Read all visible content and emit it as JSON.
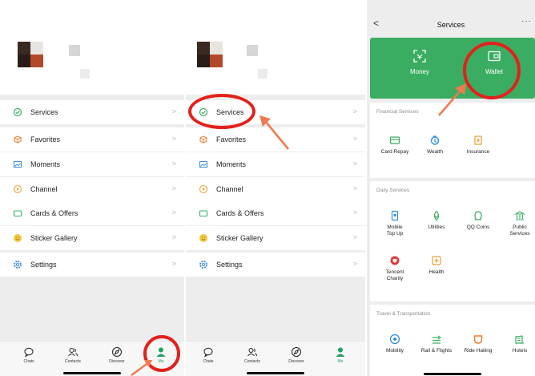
{
  "me_menu": [
    {
      "label": "Services",
      "icon": "services-icon"
    },
    {
      "label": "Favorites",
      "icon": "favorites-icon"
    },
    {
      "label": "Moments",
      "icon": "moments-icon"
    },
    {
      "label": "Channel",
      "icon": "channel-icon"
    },
    {
      "label": "Cards & Offers",
      "icon": "cards-offers-icon"
    },
    {
      "label": "Sticker Gallery",
      "icon": "sticker-gallery-icon"
    },
    {
      "label": "Settings",
      "icon": "settings-icon"
    }
  ],
  "chevron": ">",
  "tabs": [
    {
      "label": "Chats",
      "icon": "chats-icon"
    },
    {
      "label": "Contacts",
      "icon": "contacts-icon"
    },
    {
      "label": "Discover",
      "icon": "discover-icon"
    },
    {
      "label": "Me",
      "icon": "me-icon",
      "active": true
    }
  ],
  "services_page": {
    "back": "<",
    "title": "Services",
    "more": "···",
    "wallet_card": [
      {
        "label": "Money",
        "icon": "money-scan-icon"
      },
      {
        "label": "Wallet",
        "icon": "wallet-icon"
      }
    ],
    "sections": [
      {
        "title": "Financial Services",
        "items": [
          {
            "label": "Card Repay",
            "icon": "card-repay-icon"
          },
          {
            "label": "Wealth",
            "icon": "wealth-icon"
          },
          {
            "label": "Insurance",
            "icon": "insurance-icon"
          }
        ]
      },
      {
        "title": "Daily Services",
        "items": [
          {
            "label": "Mobile\nTop Up",
            "icon": "mobile-top-up-icon"
          },
          {
            "label": "Utilities",
            "icon": "utilities-icon"
          },
          {
            "label": "QQ Coins",
            "icon": "qq-coins-icon"
          },
          {
            "label": "Public\nServices",
            "icon": "public-services-icon"
          },
          {
            "label": "Tencent\nCharity",
            "icon": "tencent-charity-icon"
          },
          {
            "label": "Health",
            "icon": "health-icon"
          }
        ]
      },
      {
        "title": "Travel & Transportation",
        "items": [
          {
            "label": "Mobility",
            "icon": "mobility-icon"
          },
          {
            "label": "Rail & Flights",
            "icon": "rail-flights-icon"
          },
          {
            "label": "Ride Hailing",
            "icon": "ride-hailing-icon"
          },
          {
            "label": "Hotels",
            "icon": "hotels-icon"
          }
        ]
      }
    ]
  },
  "colors": {
    "brand_green": "#3aad62",
    "active_tab": "#1fa160",
    "highlight_red": "#e3201b",
    "arrow_orange": "#f07b50"
  }
}
